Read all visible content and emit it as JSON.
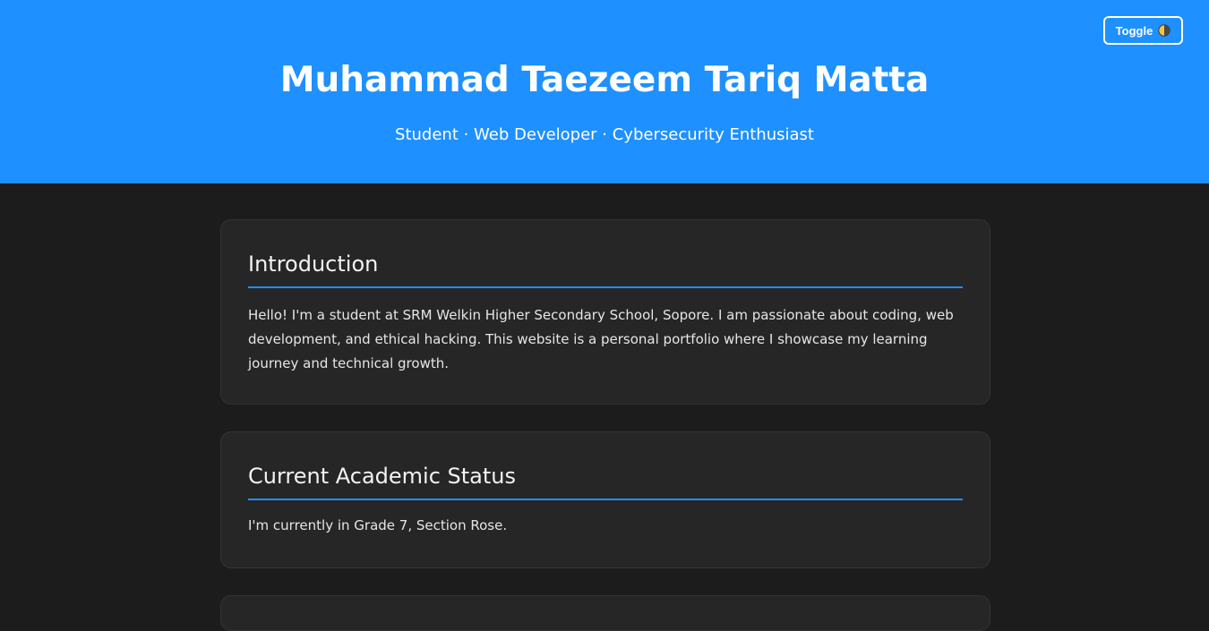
{
  "header": {
    "toggle_label": "Toggle",
    "toggle_icon": "half-moon-icon",
    "title": "Muhammad Taezeem Tariq Matta",
    "subtitle": "Student · Web Developer · Cybersecurity Enthusiast"
  },
  "sections": {
    "introduction": {
      "heading": "Introduction",
      "body": "Hello! I'm a student at SRM Welkin Higher Secondary School, Sopore. I am passionate about coding, web development, and ethical hacking. This website is a personal portfolio where I showcase my learning journey and technical growth."
    },
    "academic": {
      "heading": "Current Academic Status",
      "body": "I'm currently in Grade 7, Section Rose."
    }
  },
  "colors": {
    "accent": "#1e90ff",
    "page_background": "#1c1c1c",
    "card_background": "#262626"
  }
}
